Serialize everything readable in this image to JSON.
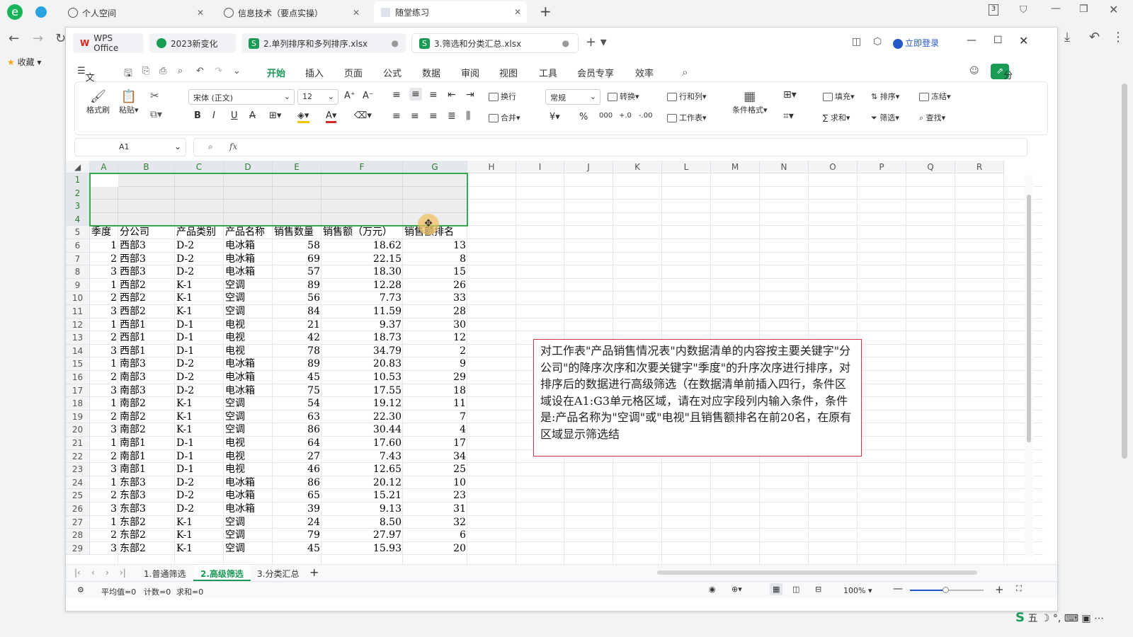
{
  "browser": {
    "tabs": [
      {
        "label": "个人空间"
      },
      {
        "label": "信息技术（要点实操）"
      },
      {
        "label": "随堂练习"
      }
    ],
    "tab_count": "3",
    "bookmark": "收藏"
  },
  "wps": {
    "tabs": [
      "WPS Office",
      "2023新变化",
      "2.单列排序和多列排序.xlsx",
      "3.筛选和分类汇总.xlsx"
    ],
    "login": "立即登录",
    "menu": [
      "文件",
      "开始",
      "插入",
      "页面",
      "公式",
      "数据",
      "审阅",
      "视图",
      "工具",
      "会员专享",
      "效率"
    ],
    "share": "分享",
    "ribbon": {
      "format_painter": "格式刷",
      "paste": "粘贴",
      "font": "宋体 (正文)",
      "size": "12",
      "wrap": "换行",
      "merge": "合并",
      "number_format": "常规",
      "convert": "转换",
      "rows_cols": "行和列",
      "worksheet": "工作表",
      "cond_format": "条件格式",
      "fill": "填充",
      "sort": "排序",
      "freeze": "冻结",
      "sum": "求和",
      "filter": "筛选",
      "find": "查找"
    },
    "namebox": "A1",
    "fx": "fx"
  },
  "columns": [
    "A",
    "B",
    "C",
    "D",
    "E",
    "F",
    "G",
    "H",
    "I",
    "J",
    "K",
    "L",
    "M",
    "N",
    "O",
    "P",
    "Q",
    "R"
  ],
  "header_row": [
    "季度",
    "分公司",
    "产品类别",
    "产品名称",
    "销售数量",
    "销售额（万元）",
    "销售额排名"
  ],
  "rows": [
    [
      "1",
      "西部3",
      "D-2",
      "电冰箱",
      "58",
      "18.62",
      "13"
    ],
    [
      "2",
      "西部3",
      "D-2",
      "电冰箱",
      "69",
      "22.15",
      "8"
    ],
    [
      "3",
      "西部3",
      "D-2",
      "电冰箱",
      "57",
      "18.30",
      "15"
    ],
    [
      "1",
      "西部2",
      "K-1",
      "空调",
      "89",
      "12.28",
      "26"
    ],
    [
      "2",
      "西部2",
      "K-1",
      "空调",
      "56",
      "7.73",
      "33"
    ],
    [
      "3",
      "西部2",
      "K-1",
      "空调",
      "84",
      "11.59",
      "28"
    ],
    [
      "1",
      "西部1",
      "D-1",
      "电视",
      "21",
      "9.37",
      "30"
    ],
    [
      "2",
      "西部1",
      "D-1",
      "电视",
      "42",
      "18.73",
      "12"
    ],
    [
      "3",
      "西部1",
      "D-1",
      "电视",
      "78",
      "34.79",
      "2"
    ],
    [
      "1",
      "南部3",
      "D-2",
      "电冰箱",
      "89",
      "20.83",
      "9"
    ],
    [
      "2",
      "南部3",
      "D-2",
      "电冰箱",
      "45",
      "10.53",
      "29"
    ],
    [
      "3",
      "南部3",
      "D-2",
      "电冰箱",
      "75",
      "17.55",
      "18"
    ],
    [
      "1",
      "南部2",
      "K-1",
      "空调",
      "54",
      "19.12",
      "11"
    ],
    [
      "2",
      "南部2",
      "K-1",
      "空调",
      "63",
      "22.30",
      "7"
    ],
    [
      "3",
      "南部2",
      "K-1",
      "空调",
      "86",
      "30.44",
      "4"
    ],
    [
      "1",
      "南部1",
      "D-1",
      "电视",
      "64",
      "17.60",
      "17"
    ],
    [
      "2",
      "南部1",
      "D-1",
      "电视",
      "27",
      "7.43",
      "34"
    ],
    [
      "3",
      "南部1",
      "D-1",
      "电视",
      "46",
      "12.65",
      "25"
    ],
    [
      "1",
      "东部3",
      "D-2",
      "电冰箱",
      "86",
      "20.12",
      "10"
    ],
    [
      "2",
      "东部3",
      "D-2",
      "电冰箱",
      "65",
      "15.21",
      "23"
    ],
    [
      "3",
      "东部3",
      "D-2",
      "电冰箱",
      "39",
      "9.13",
      "31"
    ],
    [
      "1",
      "东部2",
      "K-1",
      "空调",
      "24",
      "8.50",
      "32"
    ],
    [
      "2",
      "东部2",
      "K-1",
      "空调",
      "79",
      "27.97",
      "6"
    ],
    [
      "3",
      "东部2",
      "K-1",
      "空调",
      "45",
      "15.93",
      "20"
    ]
  ],
  "note": "对工作表\"产品销售情况表\"内数据清单的内容按主要关键字\"分公司\"的降序次序和次要关键字\"季度\"的升序次序进行排序，对排序后的数据进行高级筛选（在数据清单前插入四行，条件区域设在A1:G3单元格区域，请在对应字段列内输入条件，条件是:产品名称为\"空调\"或\"电视\"且销售额排名在前20名，在原有区域显示筛选结",
  "sheets": [
    "1.普通筛选",
    "2.高级筛选",
    "3.分类汇总"
  ],
  "status": {
    "avg": "平均值=0",
    "count": "计数=0",
    "sum": "求和=0",
    "zoom": "100%"
  },
  "colors": {
    "accent": "#1a9b54",
    "note_border": "#c8373f",
    "selection": "#2fa84f"
  }
}
